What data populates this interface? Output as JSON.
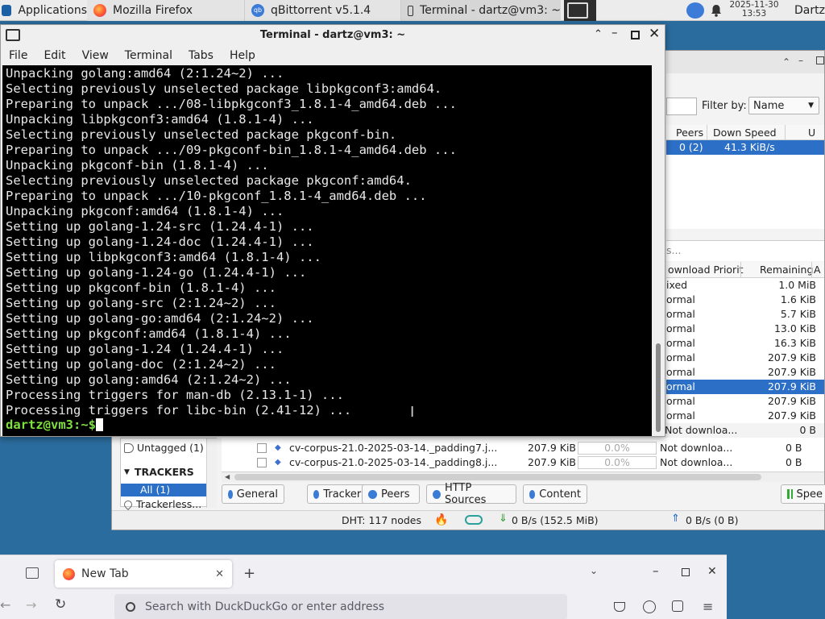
{
  "panel": {
    "apps_label": "Applications",
    "tasks": [
      {
        "label": "Mozilla Firefox",
        "icon": "firefox-icon"
      },
      {
        "label": "qBittorrent v5.1.4",
        "icon": "qbittorrent-icon"
      },
      {
        "label": "Terminal - dartz@vm3: ~",
        "icon": "terminal-icon"
      }
    ],
    "date": "2025-11-30",
    "time": "13:53",
    "user": "Dartz"
  },
  "terminal": {
    "title": "Terminal - dartz@vm3: ~",
    "menu": [
      "File",
      "Edit",
      "View",
      "Terminal",
      "Tabs",
      "Help"
    ],
    "lines": [
      "Unpacking golang:amd64 (2:1.24~2) ...",
      "Selecting previously unselected package libpkgconf3:amd64.",
      "Preparing to unpack .../08-libpkgconf3_1.8.1-4_amd64.deb ...",
      "Unpacking libpkgconf3:amd64 (1.8.1-4) ...",
      "Selecting previously unselected package pkgconf-bin.",
      "Preparing to unpack .../09-pkgconf-bin_1.8.1-4_amd64.deb ...",
      "Unpacking pkgconf-bin (1.8.1-4) ...",
      "Selecting previously unselected package pkgconf:amd64.",
      "Preparing to unpack .../10-pkgconf_1.8.1-4_amd64.deb ...",
      "Unpacking pkgconf:amd64 (1.8.1-4) ...",
      "Setting up golang-1.24-src (1.24.4-1) ...",
      "Setting up golang-1.24-doc (1.24.4-1) ...",
      "Setting up libpkgconf3:amd64 (1.8.1-4) ...",
      "Setting up golang-1.24-go (1.24.4-1) ...",
      "Setting up pkgconf-bin (1.8.1-4) ...",
      "Setting up golang-src (2:1.24~2) ...",
      "Setting up golang-go:amd64 (2:1.24~2) ...",
      "Setting up pkgconf:amd64 (1.8.1-4) ...",
      "Setting up golang-1.24 (1.24.4-1) ...",
      "Setting up golang-doc (2:1.24~2) ...",
      "Setting up golang:amd64 (2:1.24~2) ...",
      "Processing triggers for man-db (2.13.1-1) ...",
      "Processing triggers for libc-bin (2.41-12) ..."
    ],
    "prompt": "dartz@vm3:~$ "
  },
  "qbittorrent": {
    "filter_label": "Filter by:",
    "filter_value": "Name",
    "torrent_headers": [
      "Peers",
      "Down Speed",
      "U"
    ],
    "torrent_row": {
      "peers": "0 (2)",
      "down_speed": "41.3 KiB/s"
    },
    "search_hint": "s...",
    "file_headers": [
      "ownload Priorit",
      "Remaining",
      "A"
    ],
    "file_rows": [
      {
        "priority": "ixed",
        "remaining": "1.0 MiB"
      },
      {
        "priority": "ormal",
        "remaining": "1.6 KiB"
      },
      {
        "priority": "ormal",
        "remaining": "5.7 KiB"
      },
      {
        "priority": "ormal",
        "remaining": "13.0 KiB"
      },
      {
        "priority": "ormal",
        "remaining": "16.3 KiB"
      },
      {
        "priority": "ormal",
        "remaining": "207.9 KiB"
      },
      {
        "priority": "ormal",
        "remaining": "207.9 KiB"
      },
      {
        "priority": "ormal",
        "remaining": "207.9 KiB"
      },
      {
        "priority": "ormal",
        "remaining": "207.9 KiB"
      },
      {
        "priority": "ormal",
        "remaining": "207.9 KiB"
      }
    ],
    "sidebar": {
      "untagged": "Untagged (1)",
      "trackers_heading": "TRACKERS",
      "all": "All (1)",
      "trackerless": "Trackerless..."
    },
    "content_rows": [
      {
        "name": "cv-corpus-21.0-2025-03-14._padding7.j...",
        "size": "207.9 KiB",
        "progress": "0.0%",
        "priority": "Not downloa...",
        "remaining": "0 B"
      },
      {
        "name": "cv-corpus-21.0-2025-03-14._padding8.j...",
        "size": "207.9 KiB",
        "progress": "0.0%",
        "priority": "Not downloa...",
        "remaining": "0 B"
      }
    ],
    "extra_row": {
      "priority": "Not downloa...",
      "remaining": "0 B"
    },
    "tabs": [
      "General",
      "Trackers",
      "Peers",
      "HTTP Sources",
      "Content"
    ],
    "speed_btn": "Spee",
    "status": {
      "dht": "DHT: 117 nodes",
      "down": "0 B/s (152.5 MiB)",
      "up": "0 B/s (0 B)"
    }
  },
  "firefox": {
    "tab_label": "New Tab",
    "url_placeholder": "Search with DuckDuckGo or enter address"
  }
}
